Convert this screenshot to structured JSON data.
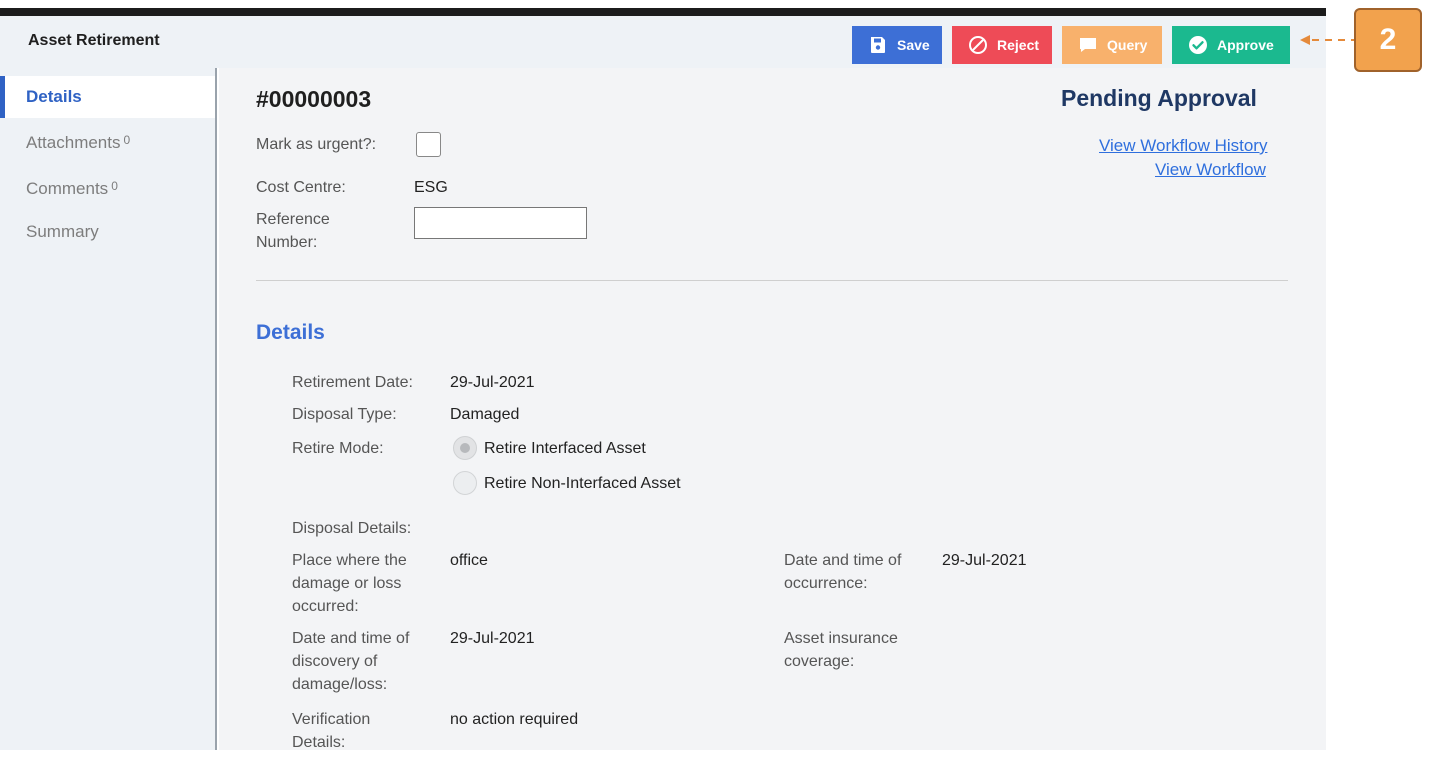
{
  "app": {
    "title": "Asset Retirement"
  },
  "toolbar": {
    "save_label": "Save",
    "reject_label": "Reject",
    "query_label": "Query",
    "approve_label": "Approve"
  },
  "callout": {
    "number": "2"
  },
  "sidebar": {
    "items": [
      {
        "label": "Details",
        "count": ""
      },
      {
        "label": "Attachments",
        "count": "0"
      },
      {
        "label": "Comments",
        "count": "0"
      },
      {
        "label": "Summary",
        "count": ""
      }
    ]
  },
  "record": {
    "number": "#00000003",
    "status": "Pending Approval",
    "links": {
      "history": "View Workflow History",
      "workflow": "View Workflow"
    },
    "urgent_label": "Mark as urgent?:",
    "cost_centre_label": "Cost Centre:",
    "cost_centre_value": "ESG",
    "reference_label_line1": "Reference",
    "reference_label_line2": "Number:",
    "reference_value": ""
  },
  "details": {
    "section_title": "Details",
    "retirement_date_label": "Retirement Date:",
    "retirement_date_value": "29-Jul-2021",
    "disposal_type_label": "Disposal Type:",
    "disposal_type_value": "Damaged",
    "retire_mode_label": "Retire Mode:",
    "retire_mode_options": [
      "Retire Interfaced Asset",
      "Retire Non-Interfaced Asset"
    ],
    "retire_mode_selected": "Retire Interfaced Asset",
    "disposal_details_label": "Disposal Details:",
    "place_label": [
      "Place where the",
      "damage or loss",
      "occurred:"
    ],
    "place_value": "office",
    "occurrence_label": [
      "Date and time of",
      "occurrence:"
    ],
    "occurrence_value": "29-Jul-2021",
    "discovery_label": [
      "Date and time of",
      "discovery of",
      "damage/loss:"
    ],
    "discovery_value": "29-Jul-2021",
    "insurance_label": [
      "Asset insurance",
      "coverage:"
    ],
    "insurance_value": "",
    "verification_label": [
      "Verification",
      "Details:"
    ],
    "verification_value": "no action required"
  },
  "colors": {
    "save": "#3d6fd6",
    "reject": "#ee4b57",
    "query": "#f8b16c",
    "approve": "#1bb98f",
    "accent": "#2f62c4",
    "status": "#1f3864",
    "callout": "#f2a24d"
  },
  "icons": {
    "save": "floppy-disk-icon",
    "reject": "prohibited-icon",
    "query": "speech-bubble-icon",
    "approve": "check-circle-icon"
  }
}
